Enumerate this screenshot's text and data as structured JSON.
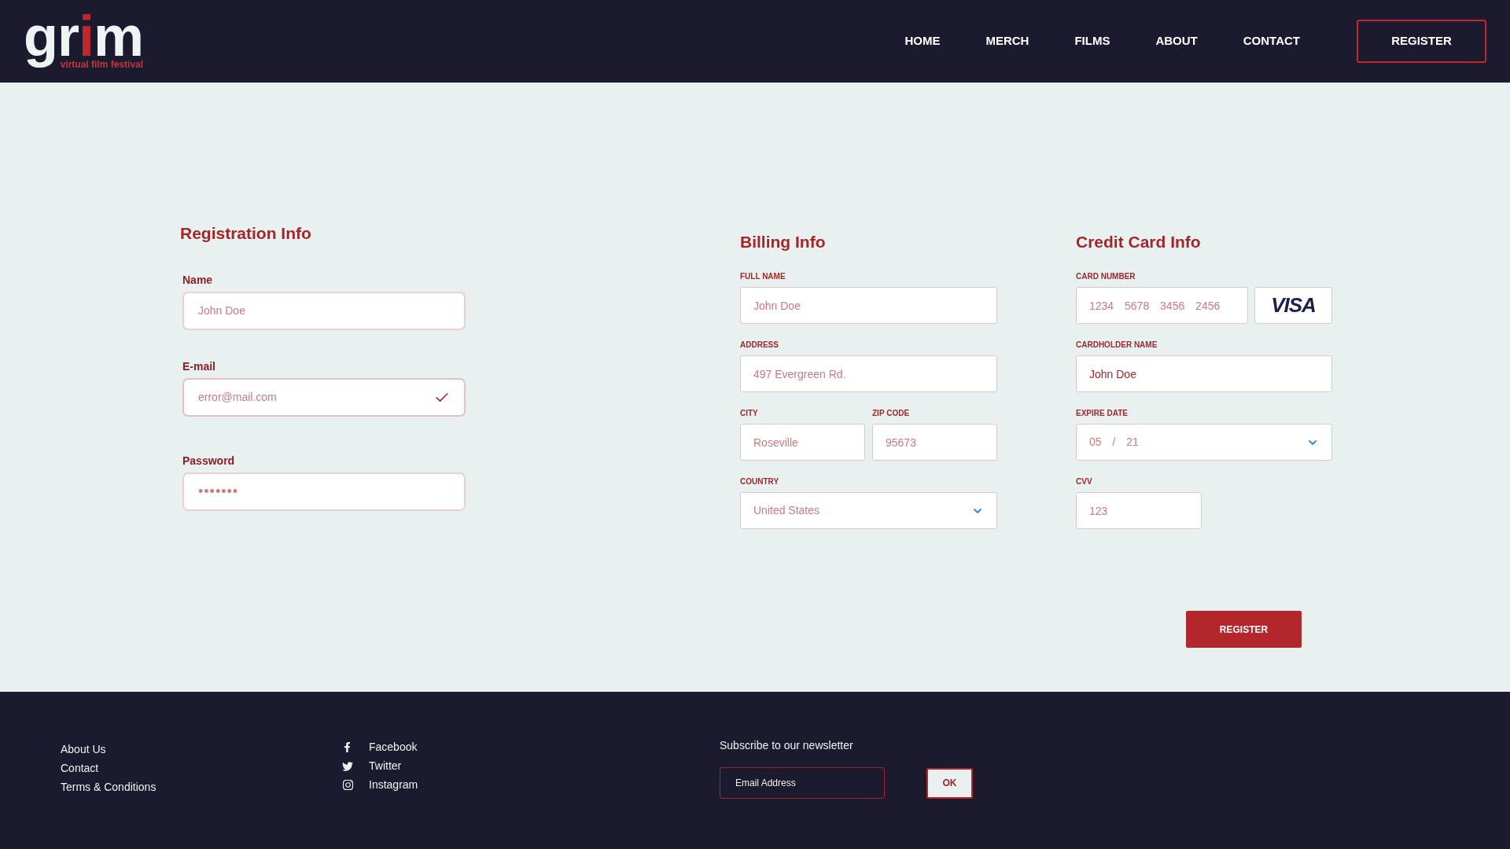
{
  "header": {
    "logo": {
      "word": "grim",
      "tagline": "virtual film festival"
    },
    "nav": [
      {
        "label": "HOME"
      },
      {
        "label": "MERCH"
      },
      {
        "label": "FILMS"
      },
      {
        "label": "ABOUT"
      },
      {
        "label": "CONTACT"
      }
    ],
    "cta": "REGISTER"
  },
  "registration": {
    "title": "Registration Info",
    "fields": [
      {
        "label": "Name",
        "placeholder": "John Doe",
        "valid": false
      },
      {
        "label": "E-mail",
        "placeholder": "error@mail.com",
        "valid": true
      },
      {
        "label": "Password",
        "value": "•••••••",
        "valid": false
      }
    ]
  },
  "billing": {
    "title": "Billing Info",
    "rows": [
      [
        {
          "label": "FULL NAME",
          "placeholder": "John Doe",
          "kind": "text"
        }
      ],
      [
        {
          "label": "ADDRESS",
          "placeholder": "497 Evergreen Rd.",
          "kind": "text"
        }
      ],
      [
        {
          "label": "CITY",
          "placeholder": "Roseville",
          "kind": "text"
        },
        {
          "label": "ZIP CODE",
          "placeholder": "95673",
          "kind": "text"
        }
      ],
      [
        {
          "label": "COUNTRY",
          "placeholder": "United States",
          "kind": "select"
        }
      ]
    ]
  },
  "credit_card": {
    "title": "Credit Card Info",
    "card_brand": "VISA",
    "fields": [
      {
        "label": "CARD NUMBER",
        "placeholder": "1234 5678 3456 2456",
        "kind": "card"
      },
      {
        "label": "CARDHOLDER NAME",
        "value": "John Doe",
        "kind": "text"
      },
      {
        "label": "EXPIRE DATE",
        "placeholder": "05 / 21",
        "kind": "date"
      },
      {
        "label": "CVV",
        "placeholder": "123",
        "kind": "short"
      }
    ],
    "submit": "REGISTER"
  },
  "footer": {
    "links": [
      "About Us",
      "Contact",
      "Terms & Conditions"
    ],
    "social": [
      {
        "label": "Facebook",
        "kind": "facebook"
      },
      {
        "label": "Twitter",
        "kind": "twitter"
      },
      {
        "label": "Instagram",
        "kind": "instagram"
      }
    ],
    "newsletter": {
      "title": "Subscribe to our newsletter",
      "placeholder": "Email Address",
      "button": "OK"
    }
  }
}
